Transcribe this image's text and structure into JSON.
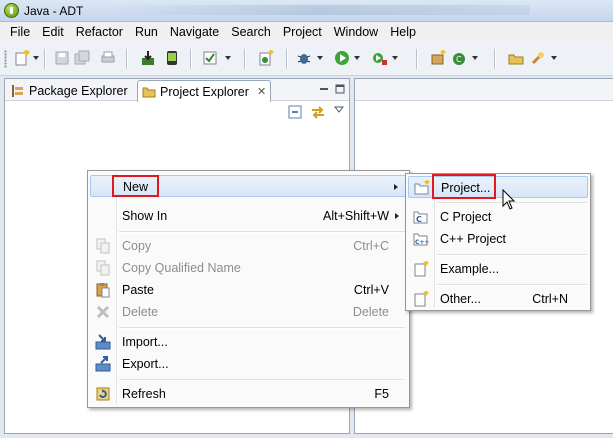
{
  "window": {
    "title": "Java - ADT"
  },
  "menubar": [
    "File",
    "Edit",
    "Refactor",
    "Run",
    "Navigate",
    "Search",
    "Project",
    "Window",
    "Help"
  ],
  "tabs": {
    "package_explorer": "Package Explorer",
    "project_explorer": "Project Explorer"
  },
  "context_menu": {
    "items": [
      {
        "label": "New",
        "accel": "",
        "submenu": true,
        "enabled": true,
        "icon": "none"
      },
      {
        "label": "Show In",
        "accel": "Alt+Shift+W",
        "submenu": true,
        "enabled": true,
        "icon": "none"
      },
      {
        "label": "Copy",
        "accel": "Ctrl+C",
        "submenu": false,
        "enabled": false,
        "icon": "copy-icon"
      },
      {
        "label": "Copy Qualified Name",
        "accel": "",
        "submenu": false,
        "enabled": false,
        "icon": "copy-icon"
      },
      {
        "label": "Paste",
        "accel": "Ctrl+V",
        "submenu": false,
        "enabled": true,
        "icon": "paste-icon"
      },
      {
        "label": "Delete",
        "accel": "Delete",
        "submenu": false,
        "enabled": false,
        "icon": "delete-icon"
      },
      {
        "label": "Import...",
        "accel": "",
        "submenu": false,
        "enabled": true,
        "icon": "import-icon"
      },
      {
        "label": "Export...",
        "accel": "",
        "submenu": false,
        "enabled": true,
        "icon": "export-icon"
      },
      {
        "label": "Refresh",
        "accel": "F5",
        "submenu": false,
        "enabled": true,
        "icon": "refresh-icon"
      }
    ]
  },
  "new_submenu": {
    "items": [
      {
        "label": "Project...",
        "accel": "",
        "icon": "new-project-icon"
      },
      {
        "label": "C Project",
        "accel": "",
        "icon": "c-project-icon"
      },
      {
        "label": "C++ Project",
        "accel": "",
        "icon": "cpp-project-icon"
      },
      {
        "label": "Example...",
        "accel": "",
        "icon": "new-example-icon"
      },
      {
        "label": "Other...",
        "accel": "Ctrl+N",
        "icon": "new-wizard-icon"
      }
    ]
  },
  "colors": {
    "highlight_border": "#e0191d",
    "menu_highlight": "#d7e6f8",
    "disabled_text": "#8d8d8d"
  }
}
